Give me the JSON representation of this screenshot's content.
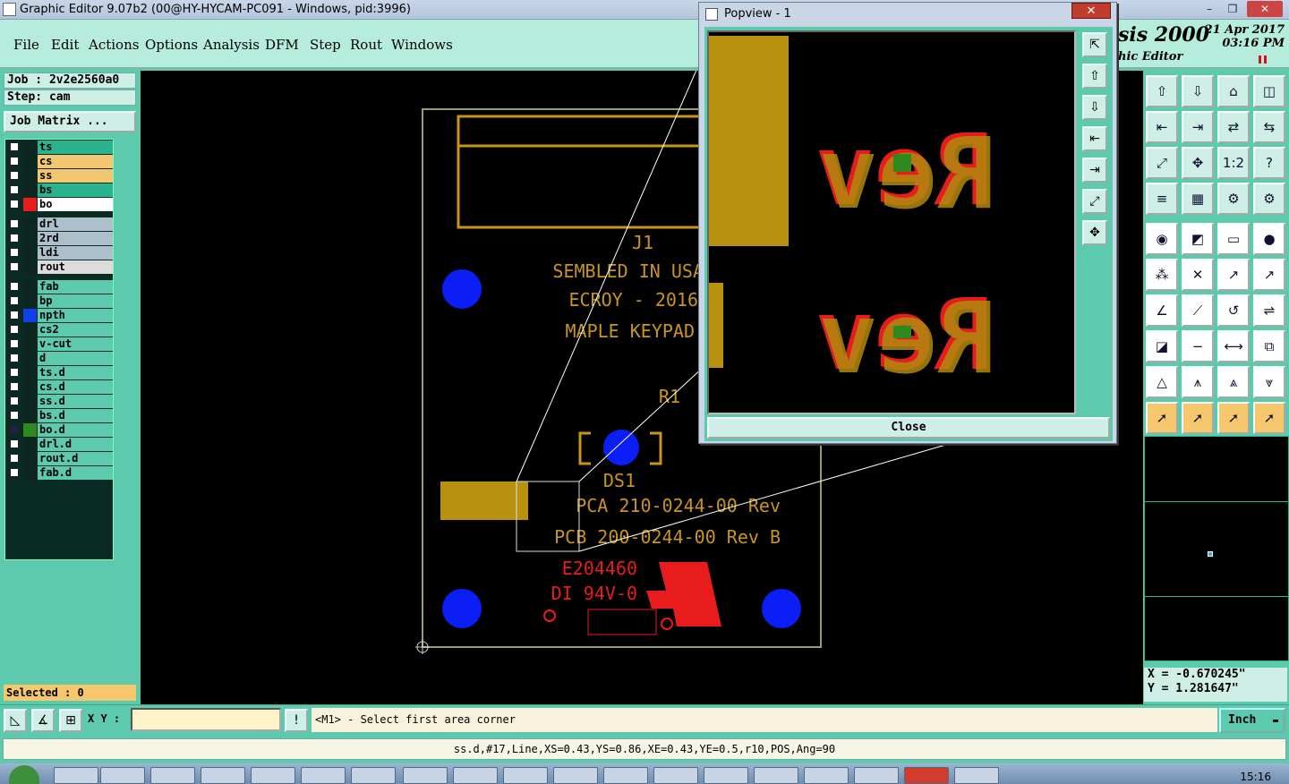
{
  "window": {
    "title": "Graphic Editor 9.07b2 (00@HY-HYCAM-PC091 - Windows, pid:3996)",
    "buttons": [
      "–",
      "❐",
      "✕"
    ]
  },
  "menu": [
    "File",
    "Edit",
    "Actions",
    "Options",
    "Analysis",
    "DFM",
    "Step",
    "Rout",
    "Windows"
  ],
  "brand": {
    "name": "sis 2000",
    "sub": "hic Editor",
    "date": "21 Apr 2017",
    "time": "03:16 PM"
  },
  "job": {
    "job_line": "Job : 2v2e2560a0",
    "step_line": "Step: cam",
    "matrix_button": "Job Matrix ..."
  },
  "layers": [
    {
      "name": "ts",
      "bg": "#2bb38f",
      "color": "#0d2620"
    },
    {
      "name": "cs",
      "bg": "#f3c770",
      "color": "#0d2620"
    },
    {
      "name": "ss",
      "bg": "#f3c770",
      "color": "#0d2620"
    },
    {
      "name": "bs",
      "bg": "#2bb38f",
      "color": "#0d2620"
    },
    {
      "name": "bo",
      "bg": "#ffffff",
      "color": "#e81c1c"
    },
    {
      "name": "drl",
      "bg": "#aebfcc",
      "color": "#0d2620"
    },
    {
      "name": "2rd",
      "bg": "#aebfcc",
      "color": "#0d2620"
    },
    {
      "name": "ldi",
      "bg": "#aebfcc",
      "color": "#0d2620"
    },
    {
      "name": "rout",
      "bg": "#dcdcdc",
      "color": "#0d2620"
    },
    {
      "name": "fab",
      "bg": "#5dc9ad",
      "color": "#0d2620"
    },
    {
      "name": "bp",
      "bg": "#5dc9ad",
      "color": "#0d2620"
    },
    {
      "name": "npth",
      "bg": "#5dc9ad",
      "color": "#1040e8"
    },
    {
      "name": "cs2",
      "bg": "#5dc9ad",
      "color": "#0d2620"
    },
    {
      "name": "v-cut",
      "bg": "#5dc9ad",
      "color": "#0d2620"
    },
    {
      "name": "d",
      "bg": "#5dc9ad",
      "color": "#0d2620"
    },
    {
      "name": "ts.d",
      "bg": "#5dc9ad",
      "color": "#0d2620"
    },
    {
      "name": "cs.d",
      "bg": "#5dc9ad",
      "color": "#0d2620"
    },
    {
      "name": "ss.d",
      "bg": "#5dc9ad",
      "color": "#0d2620"
    },
    {
      "name": "bs.d",
      "bg": "#5dc9ad",
      "color": "#0d2620"
    },
    {
      "name": "bo.d",
      "bg": "#5dc9ad",
      "color": "#2e8a1f",
      "checked": true
    },
    {
      "name": "drl.d",
      "bg": "#5dc9ad",
      "color": "#0d2620"
    },
    {
      "name": "rout.d",
      "bg": "#5dc9ad",
      "color": "#0d2620"
    },
    {
      "name": "fab.d",
      "bg": "#5dc9ad",
      "color": "#0d2620"
    }
  ],
  "selected_status": "Selected : 0",
  "board": {
    "silk_lines": [
      "J1",
      "SEMBLED IN USA",
      "ECROY - 2016",
      "MAPLE KEYPAD",
      "R1",
      "DS1",
      "PCA 210-0244-00 Rev",
      "PCB 200-0244-00 Rev B"
    ],
    "red_lines": [
      "E204460",
      "DI 94V-0"
    ]
  },
  "popview": {
    "title": "Popview - 1",
    "close_label": "Close",
    "text_top": "Rev",
    "text_bottom": "Rev"
  },
  "toolbar_icons": [
    "export-up",
    "export-down",
    "home",
    "window-split",
    "pan-left",
    "pan-right",
    "zoom-fit",
    "redraw",
    "zoom-box",
    "zoom-center",
    "scale-1-2",
    "help",
    "measure",
    "grid",
    "snap-on",
    "snap-off",
    "pad-tool",
    "line-tool",
    "ruler",
    "circle-tool",
    "node-tool",
    "cross-tool",
    "arc-ccw",
    "arc-cw",
    "angle-tool",
    "slope-tool",
    "arc-tool",
    "fit-tool",
    "copy-tool",
    "minus-tool",
    "midpoint-tool",
    "group-tool",
    "triangle-tool",
    "arrow-up-tool",
    "arrow-a-tool",
    "arrow-b-tool",
    "select-arrow",
    "select-box",
    "select-cursor",
    "select-path"
  ],
  "toolbar_glyphs": [
    "⇧",
    "⇩",
    "⌂",
    "◫",
    "⇤",
    "⇥",
    "⇄",
    "⇆",
    "⤢",
    "✥",
    "1:2",
    "?",
    "≡",
    "▦",
    "⚙",
    "⚙",
    "◉",
    "◩",
    "▭",
    "●",
    "⁂",
    "✕",
    "↗",
    "↗",
    "∠",
    "⟋",
    "↺",
    "⇌",
    "◪",
    "−",
    "⟷",
    "⧉",
    "△",
    "⩚",
    "⩓",
    "⩔",
    "➚",
    "➚",
    "➚",
    "➚"
  ],
  "coords": {
    "x": "X = -0.670245\"",
    "y": "Y = 1.281647\""
  },
  "command": {
    "xy_label": "X Y :",
    "xy_value": "",
    "prompt": "<M1> - Select first area corner",
    "units": "Inch"
  },
  "status_line": "ss.d,#17,Line,XS=0.43,YS=0.86,XE=0.43,YE=0.5,r10,POS,Ang=90",
  "taskbar": {
    "clock": "15:16"
  }
}
